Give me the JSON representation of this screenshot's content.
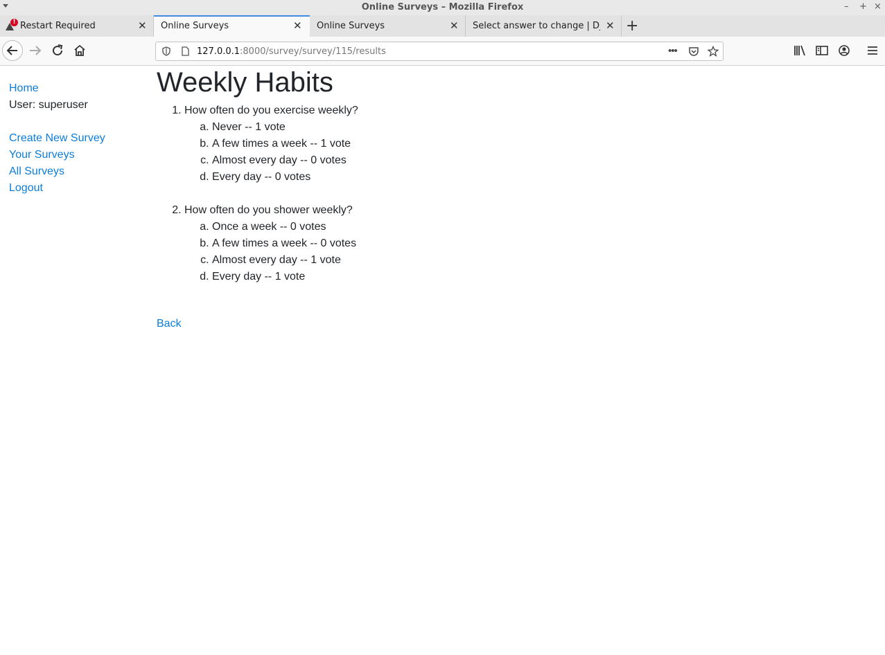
{
  "window": {
    "title": "Online Surveys – Mozilla Firefox"
  },
  "tabs": [
    {
      "label": "Restart Required",
      "icon": "warning-icon",
      "active": false
    },
    {
      "label": "Online Surveys",
      "active": true
    },
    {
      "label": "Online Surveys",
      "active": false
    },
    {
      "label": "Select answer to change | Django",
      "active": false
    }
  ],
  "navbar": {
    "url_host": "127.0.0.1",
    "url_path": ":8000/survey/survey/115/results"
  },
  "sidebar": {
    "home": "Home",
    "user": "User: superuser",
    "links": [
      "Create New Survey",
      "Your Surveys",
      "All Surveys",
      "Logout"
    ]
  },
  "survey": {
    "title": "Weekly Habits",
    "questions": [
      {
        "text": "How often do you exercise weekly?",
        "answers": [
          {
            "text": "Never -- 1 vote",
            "votes": 1
          },
          {
            "text": "A few times a week -- 1 vote",
            "votes": 1
          },
          {
            "text": "Almost every day -- 0 votes",
            "votes": 0
          },
          {
            "text": "Every day -- 0 votes",
            "votes": 0
          }
        ]
      },
      {
        "text": "How often do you shower weekly?",
        "answers": [
          {
            "text": "Once a week -- 0 votes",
            "votes": 0
          },
          {
            "text": "A few times a week -- 0 votes",
            "votes": 0
          },
          {
            "text": "Almost every day -- 1 vote",
            "votes": 1
          },
          {
            "text": "Every day -- 1 vote",
            "votes": 1
          }
        ]
      }
    ],
    "back_label": "Back"
  },
  "colors": {
    "link": "#0b7ddb",
    "text": "#212529",
    "active_tab_accent": "#3d8ae0"
  }
}
